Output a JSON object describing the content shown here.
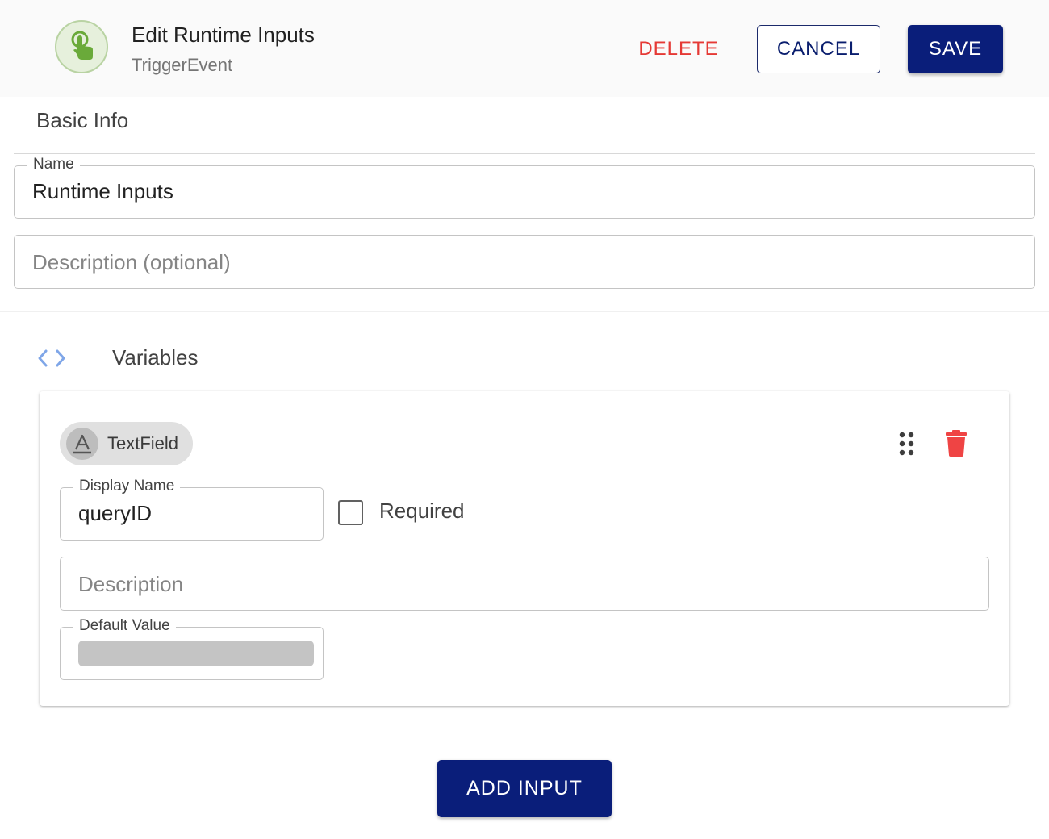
{
  "header": {
    "title": "Edit Runtime Inputs",
    "subtitle": "TriggerEvent",
    "delete_label": "DELETE",
    "cancel_label": "CANCEL",
    "save_label": "SAVE",
    "icon": "touch-app-icon"
  },
  "basic_info": {
    "section_title": "Basic Info",
    "name_label": "Name",
    "name_value": "Runtime Inputs",
    "description_placeholder": "Description (optional)"
  },
  "variables": {
    "section_title": "Variables",
    "icon": "code-icon",
    "items": [
      {
        "type_chip_label": "TextField",
        "type_icon": "text-format-icon",
        "display_name_label": "Display Name",
        "display_name_value": "queryID",
        "required_label": "Required",
        "required_checked": false,
        "description_placeholder": "Description",
        "default_value_label": "Default Value"
      }
    ]
  },
  "footer": {
    "add_input_label": "ADD INPUT"
  },
  "colors": {
    "primary": "#0a1e7a",
    "danger": "#e53935",
    "icon_green": "#6aaa3a"
  }
}
